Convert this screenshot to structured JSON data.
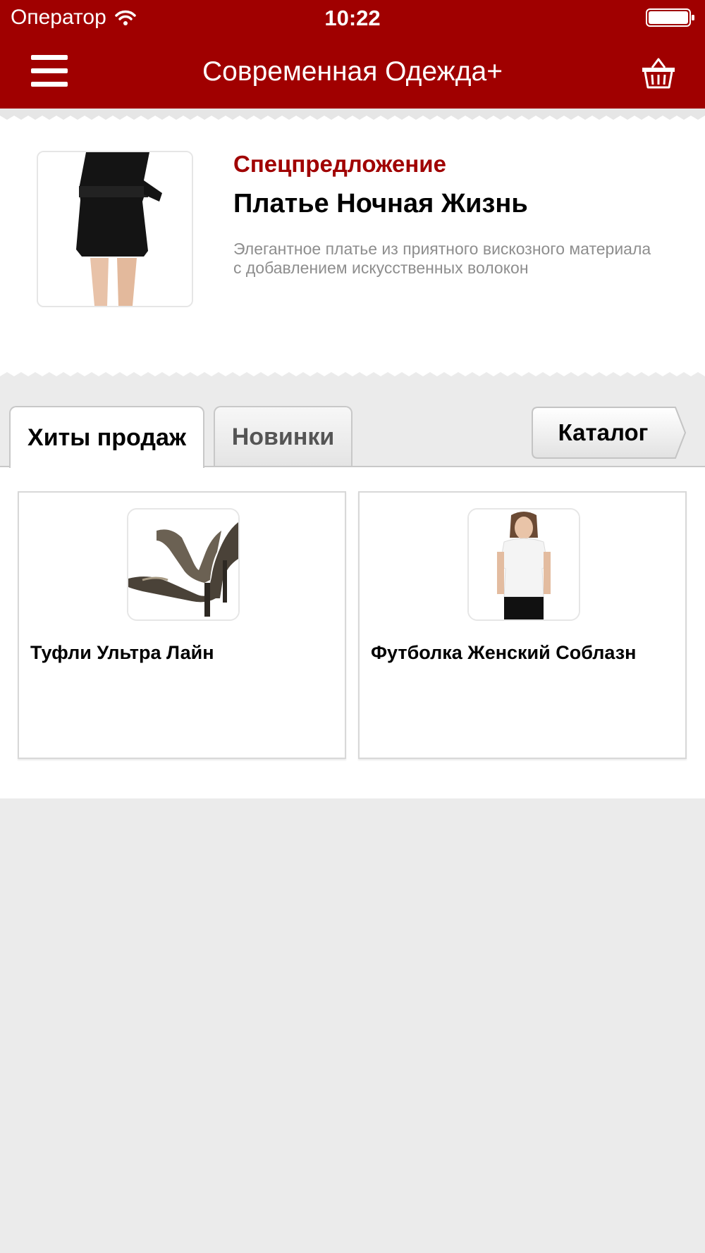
{
  "status_bar": {
    "carrier": "Оператор",
    "time": "10:22"
  },
  "header": {
    "title": "Современная Одежда+",
    "menu_icon": "hamburger-menu-icon",
    "cart_icon": "shopping-basket-icon"
  },
  "offer": {
    "label": "Спецпредложение",
    "title": "Платье Ночная Жизнь",
    "description": "Элегантное платье из приятного вискозного материала с добавлением искусственных волокон"
  },
  "tabs": [
    {
      "label": "Хиты продаж",
      "active": true
    },
    {
      "label": "Новинки",
      "active": false
    }
  ],
  "catalog_button": "Каталог",
  "products": [
    {
      "name": "Туфли Ультра Лайн"
    },
    {
      "name": "Футболка Женский Соблазн"
    }
  ],
  "colors": {
    "brand": "#a00000",
    "background": "#ebebeb"
  }
}
